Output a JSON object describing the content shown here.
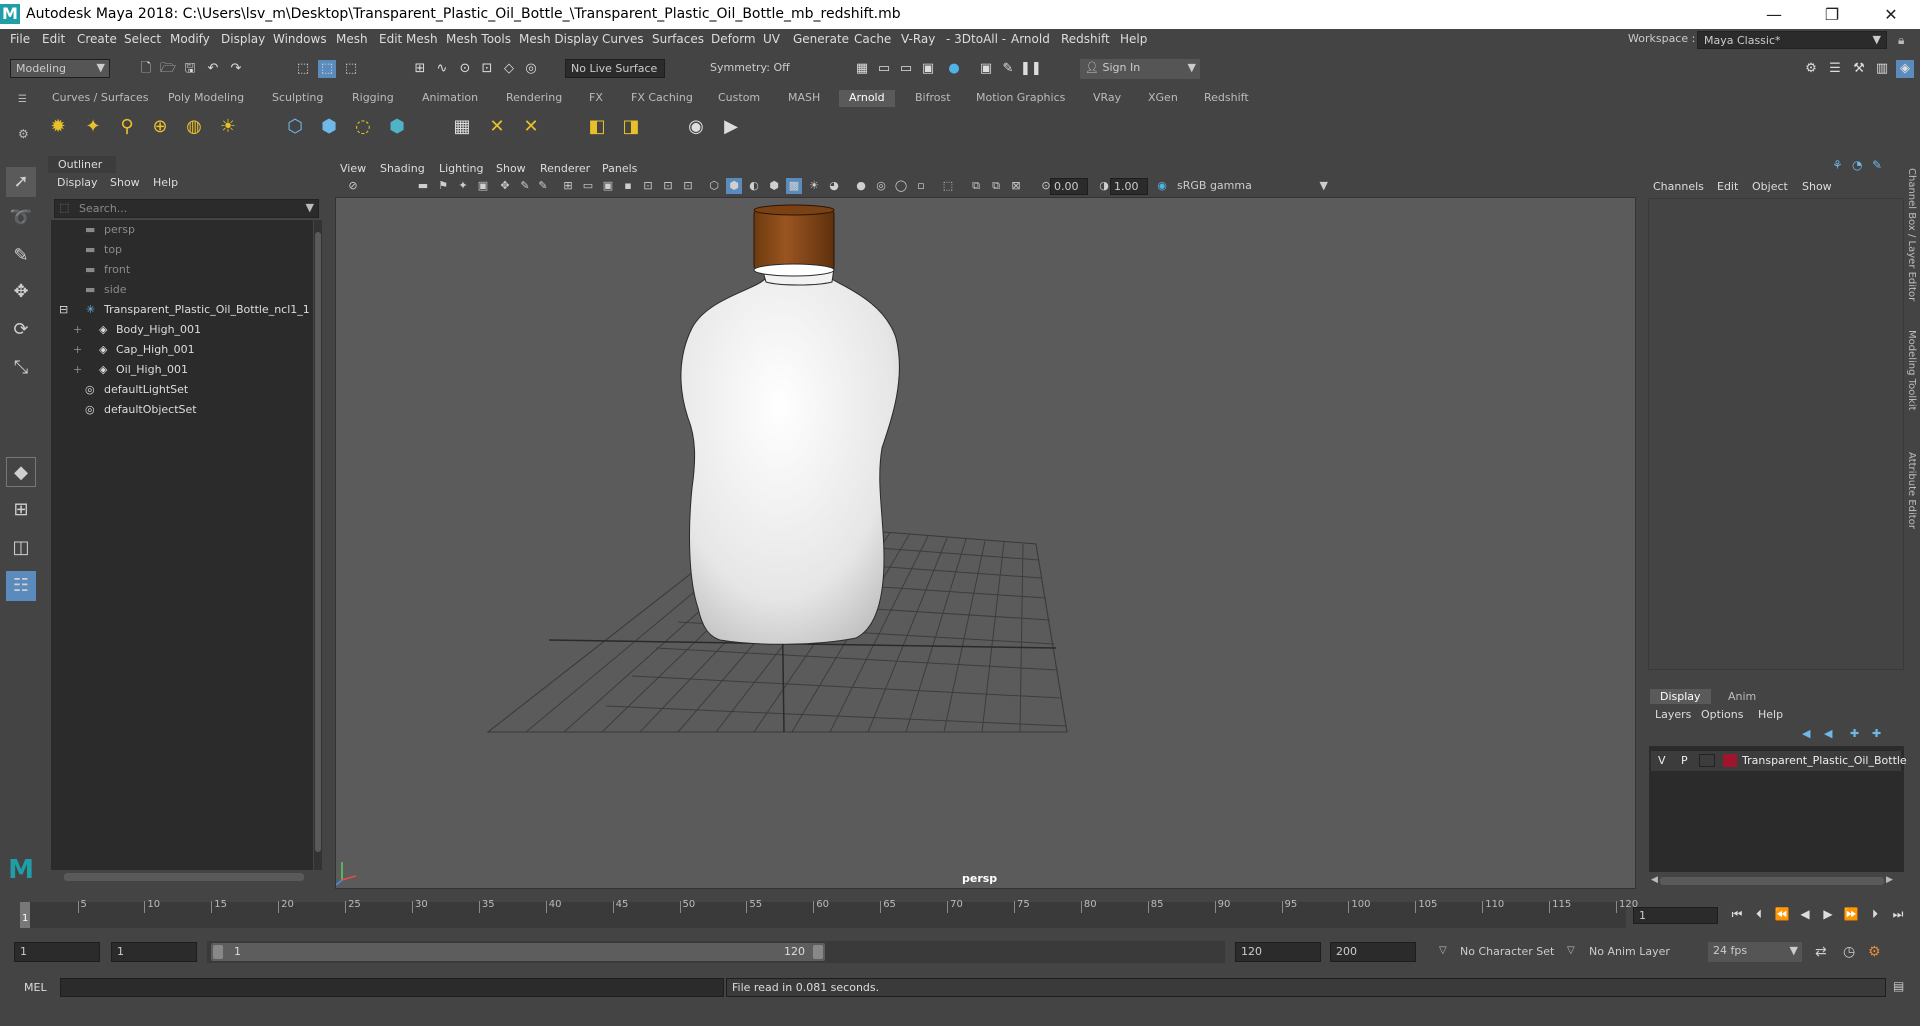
{
  "window": {
    "app_logo": "M",
    "title": "Autodesk Maya 2018: C:\\Users\\lsv_m\\Desktop\\Transparent_Plastic_Oil_Bottle_\\Transparent_Plastic_Oil_Bottle_mb_redshift.mb",
    "minimize": "—",
    "maximize": "❐",
    "close": "✕"
  },
  "menubar": {
    "items": [
      "File",
      "Edit",
      "Create",
      "Select",
      "Modify",
      "Display",
      "Windows",
      "Mesh",
      "Edit Mesh",
      "Mesh Tools",
      "Mesh Display",
      "Curves",
      "Surfaces",
      "Deform",
      "UV",
      "Generate",
      "Cache",
      "V-Ray",
      "- 3DtoAll -",
      "Arnold",
      "Redshift",
      "Help"
    ],
    "workspace_label": "Workspace :",
    "workspace_value": "Maya Classic*"
  },
  "statusline": {
    "mode": "Modeling",
    "live_surface": "No Live Surface",
    "symmetry": "Symmetry: Off",
    "sign_in": "Sign In"
  },
  "shelf": {
    "tabs": [
      "Curves / Surfaces",
      "Poly Modeling",
      "Sculpting",
      "Rigging",
      "Animation",
      "Rendering",
      "FX",
      "FX Caching",
      "Custom",
      "MASH",
      "Arnold",
      "Bifrost",
      "Motion Graphics",
      "VRay",
      "XGen",
      "Redshift"
    ],
    "active_tab": "Arnold"
  },
  "outliner": {
    "tab": "Outliner",
    "menu": [
      "Display",
      "Show",
      "Help"
    ],
    "search_placeholder": "Search...",
    "items": [
      {
        "label": "persp",
        "icon": "camera-icon",
        "dim": true
      },
      {
        "label": "top",
        "icon": "camera-icon",
        "dim": true
      },
      {
        "label": "front",
        "icon": "camera-icon",
        "dim": true
      },
      {
        "label": "side",
        "icon": "camera-icon",
        "dim": true
      },
      {
        "label": "Transparent_Plastic_Oil_Bottle_ncl1_1",
        "icon": "group-icon",
        "dim": false
      },
      {
        "label": "Body_High_001",
        "icon": "mesh-icon",
        "dim": false
      },
      {
        "label": "Cap_High_001",
        "icon": "mesh-icon",
        "dim": false
      },
      {
        "label": "Oil_High_001",
        "icon": "mesh-icon",
        "dim": false
      },
      {
        "label": "defaultLightSet",
        "icon": "set-icon",
        "dim": false
      },
      {
        "label": "defaultObjectSet",
        "icon": "set-icon",
        "dim": false
      }
    ]
  },
  "viewport": {
    "menu": [
      "View",
      "Shading",
      "Lighting",
      "Show",
      "Renderer",
      "Panels"
    ],
    "exposure": "0.00",
    "gamma": "1.00",
    "color_space": "sRGB gamma",
    "camera_label": "persp",
    "cap_color": "#8a4a16",
    "bottle_color": "#e8e8e8"
  },
  "channelbox": {
    "menu": [
      "Channels",
      "Edit",
      "Object",
      "Show"
    ],
    "side_tabs": [
      "Channel Box / Layer Editor",
      "Modeling Toolkit",
      "Attribute Editor"
    ]
  },
  "layer_editor": {
    "tabs": [
      "Display",
      "Anim"
    ],
    "active_tab": "Display",
    "menu": [
      "Layers",
      "Options",
      "Help"
    ],
    "layer": {
      "v": "V",
      "p": "P",
      "name": "Transparent_Plastic_Oil_Bottle",
      "color": "#a0142c"
    }
  },
  "timeline": {
    "ticks": [
      1,
      5,
      10,
      15,
      20,
      25,
      30,
      35,
      40,
      45,
      50,
      55,
      60,
      65,
      70,
      75,
      80,
      85,
      90,
      95,
      100,
      105,
      110,
      115,
      120
    ],
    "current_frame": "1",
    "current_frame_field": "1"
  },
  "range": {
    "start": "1",
    "start_inner": "1",
    "slider_start": "1",
    "slider_end": "120",
    "end_inner": "120",
    "end": "200",
    "character_set": "No Character Set",
    "anim_layer": "No Anim Layer",
    "fps": "24 fps"
  },
  "command": {
    "language": "MEL",
    "result": "File read in  0.081 seconds."
  }
}
